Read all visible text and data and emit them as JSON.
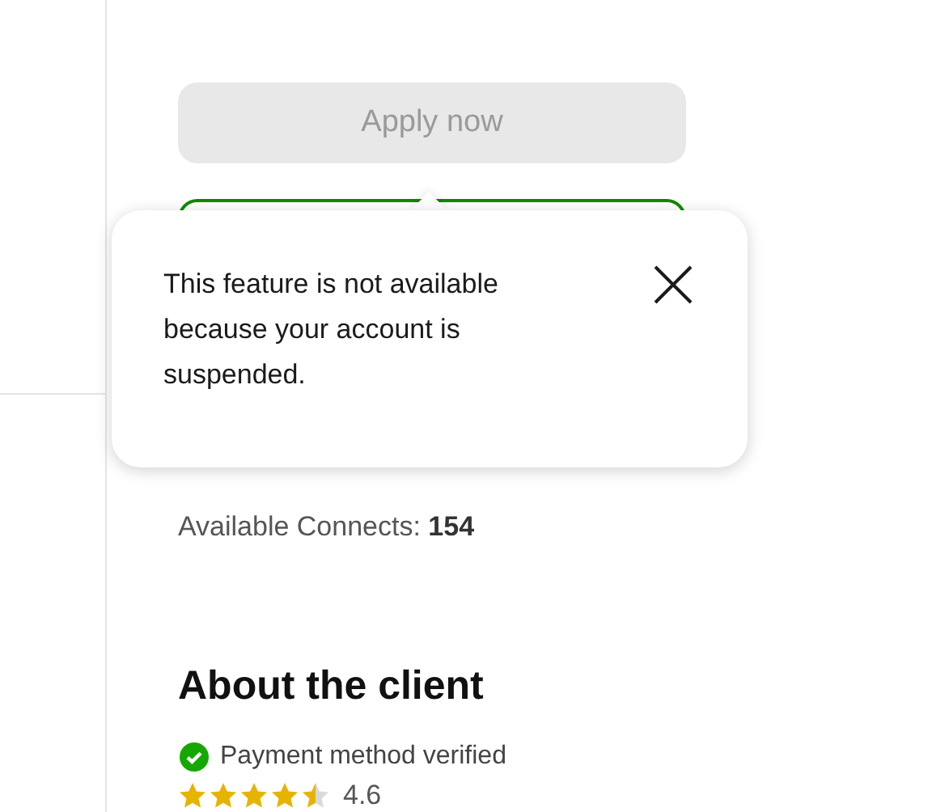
{
  "apply_button": {
    "label": "Apply now",
    "disabled": true
  },
  "popover": {
    "message": "This feature is not available because your account is suspended."
  },
  "connects": [
    "Available Connects: **154**"
  ],
  "client": {
    "heading": "About the client",
    "payment": {
      "label": "Payment method verified",
      "verified": true
    },
    "stars": 4.5,
    "rating": "4.6"
  }
}
